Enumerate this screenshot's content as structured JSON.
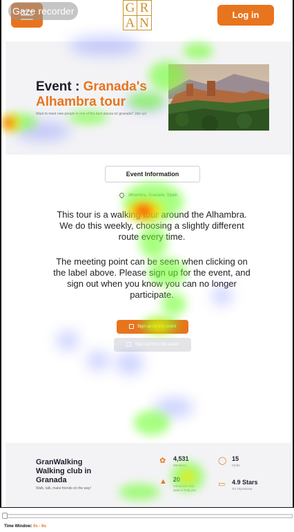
{
  "recorder": {
    "label": "Gaze recorder"
  },
  "header": {
    "logo_letters": [
      "G",
      "R",
      "A",
      "N"
    ],
    "login_label": "Log in"
  },
  "hero": {
    "title_prefix": "Event : ",
    "title_accent": "Granada's Alhambra tour",
    "subtitle": "Want to meet new people in one of the best places on granada? Join us!"
  },
  "event": {
    "tab_label": "Event Information",
    "location": "Alhambra, Granada, Spain",
    "description_1": "This tour is a walking tour around the Alhambra. We do this weekly, choosing a slightly different route every time.",
    "description_2": "The meeting point can be seen when clicking on the label above. Please sign up for the event, and sign out when you know you can no longer participate.",
    "signup_label": "Sign up for this event",
    "signout_label": "Sign out from this event"
  },
  "footer": {
    "club_name": "GranWalking Walking club in Granada",
    "tagline": "Walk, talk, make friends on the way!",
    "stats": [
      {
        "value": "4,531",
        "label": "Members",
        "icon": "users-icon"
      },
      {
        "value": "15",
        "label": "Clubs",
        "icon": "bike-icon"
      },
      {
        "value": "20",
        "label": "Volunteers that want to help you",
        "icon": "hands-icon"
      },
      {
        "value": "4.9 Stars",
        "label": "On TripAdvisor",
        "icon": "card-icon"
      }
    ]
  },
  "timeline": {
    "label": "Time Window:",
    "value": "0s - 6s"
  },
  "colors": {
    "accent": "#e8741e",
    "logo_gold": "#c9922c",
    "heat_hot": "#ff2a00",
    "heat_warm": "#ffe600",
    "heat_mid": "#6dff2a",
    "heat_cool": "#4a5cff"
  }
}
